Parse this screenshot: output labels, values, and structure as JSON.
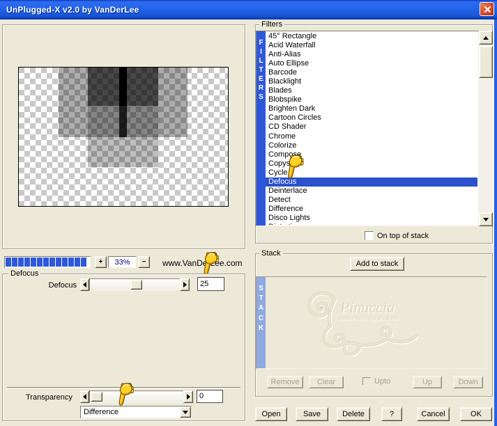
{
  "window": {
    "title": "UnPlugged-X v2.0 by VanDerLee"
  },
  "preview": {
    "zoom_in": "+",
    "zoom_percent": "33%",
    "zoom_out": "−",
    "url_text": "www.VanDerLee.com"
  },
  "filters": {
    "group_label": "Filters",
    "vertical_label": "FILTERS",
    "items": [
      "45° Rectangle",
      "Acid Waterfall",
      "Anti-Alias",
      "Auto Ellipse",
      "Barcode",
      "Blacklight",
      "Blades",
      "Blobspike",
      "Brighten Dark",
      "Cartoon Circles",
      "CD Shader",
      "Chrome",
      "Colorize",
      "Compose",
      "Copys",
      "Cycle",
      "Defocus",
      "Deinterlace",
      "Detect",
      "Difference",
      "Disco Lights",
      "Distortion"
    ],
    "selected": "Defocus",
    "selected_index": 16,
    "on_top_checkbox_label": "On top of stack"
  },
  "defocus": {
    "group_label": "Defocus",
    "slider_label": "Defocus",
    "value": "25",
    "transparency_label": "Transparency",
    "transparency_value": "0",
    "blend_mode": "Difference"
  },
  "stack": {
    "group_label": "Stack",
    "vertical_label": "STACK",
    "add_button": "Add to stack",
    "remove_button": "Remove",
    "clear_button": "Clear",
    "upto_checkbox_label": "Upto",
    "up_button": "Up",
    "down_button": "Down",
    "watermark_title": "Pinuccia",
    "watermark_url": "www.maidiregrafica.eu"
  },
  "dialog_buttons": {
    "open": "Open",
    "save": "Save",
    "delete": "Delete",
    "help": "?",
    "cancel": "Cancel",
    "ok": "OK"
  },
  "colors": {
    "accent_blue": "#2e58dc",
    "selection_blue": "#2b52cc",
    "stack_bar_blue": "#8fa9e2",
    "title_top": "#2f6cf0",
    "title_bottom": "#0c3db4",
    "dialog_bg": "#ece9d8"
  }
}
